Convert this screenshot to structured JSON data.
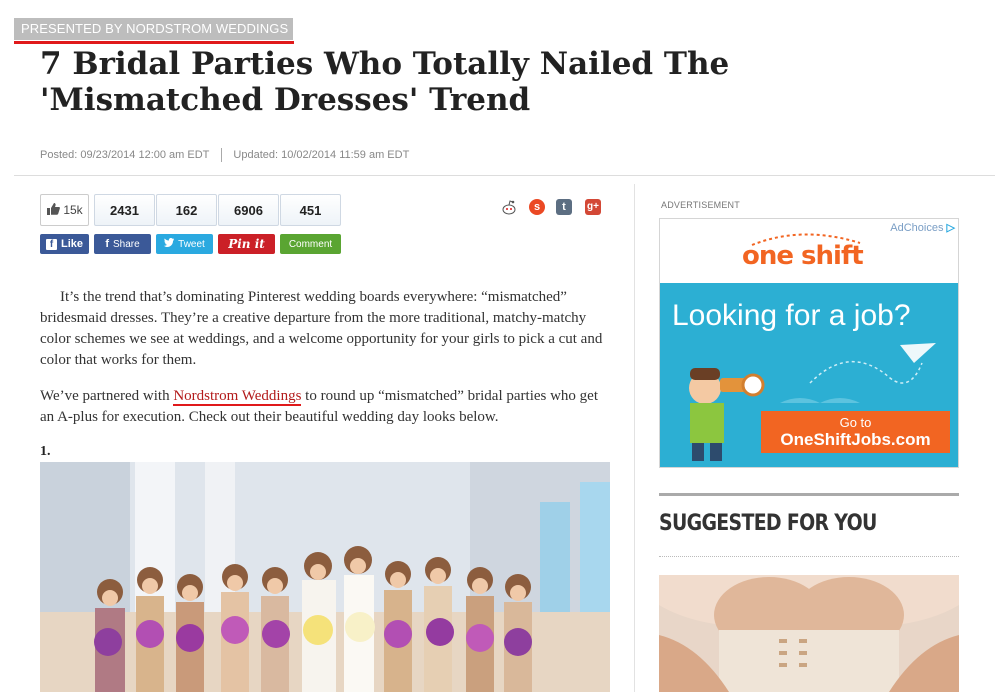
{
  "header": {
    "presented_by": "PRESENTED BY NORDSTROM WEDDINGS",
    "title": "7 Bridal Parties Who Totally Nailed The 'Mismatched Dresses' Trend",
    "posted": "Posted: 09/23/2014 12:00 am EDT",
    "updated": "Updated: 10/02/2014 11:59 am EDT"
  },
  "share": {
    "like_count": "15k",
    "counts": [
      "2431",
      "162",
      "6906",
      "451"
    ],
    "buttons": {
      "like": "Like",
      "share": "Share",
      "tweet": "Tweet",
      "pin": "Pin it",
      "comment": "Comment"
    },
    "icons": [
      "reddit-icon",
      "stumbleupon-icon",
      "tumblr-icon",
      "google-plus-icon"
    ],
    "colors": {
      "facebook": "#3b5998",
      "twitter": "#2aa9e0",
      "pinterest": "#cb2027",
      "comment": "#5aa532"
    }
  },
  "article": {
    "p1": "It’s the trend that’s dominating Pinterest wedding boards everywhere: “mismatched” bridesmaid dresses. They’re a creative departure from the more traditional, matchy-matchy color schemes we see at weddings, and a welcome opportunity for your girls to pick a cut and color that works for them.",
    "p2_before": "We’ve partnered with ",
    "p2_link": "Nordstrom Weddings",
    "p2_after": " to round up “mismatched” bridal parties who get an A-plus for execution. Check out their beautiful wedding day looks below.",
    "list_number": "1."
  },
  "sidebar": {
    "ad_label": "ADVERTISEMENT",
    "ad": {
      "adchoices": "AdChoices",
      "logo": "one shift",
      "slogan": "Looking for a job?",
      "cta_line1": "Go to",
      "cta_line2": "OneShiftJobs.com"
    },
    "suggested_title": "SUGGESTED FOR YOU"
  }
}
